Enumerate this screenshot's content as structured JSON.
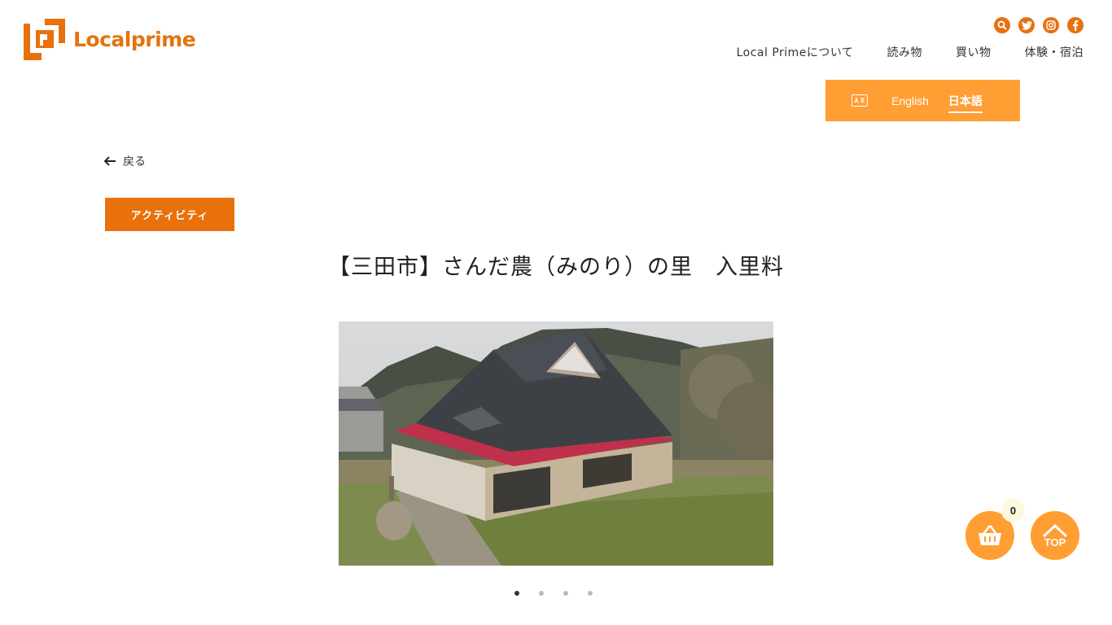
{
  "brand": {
    "name": "Localprime",
    "color": "#e6720e",
    "accent": "#ff9e33"
  },
  "social": [
    "search-icon",
    "twitter-icon",
    "instagram-icon",
    "facebook-icon"
  ],
  "nav": {
    "items": [
      "Local Primeについて",
      "読み物",
      "買い物",
      "体験・宿泊"
    ]
  },
  "language": {
    "icon": "translate-icon",
    "english": "English",
    "japanese": "日本語",
    "selected": "日本語"
  },
  "back": {
    "label": "戻る"
  },
  "category": {
    "label": "アクティビティ"
  },
  "page": {
    "title": "【三田市】さんだ農（みのり）の里　入里料"
  },
  "carousel": {
    "count": 4,
    "active": 1
  },
  "cart": {
    "count": "0"
  },
  "top_button": {
    "label": "TOP"
  }
}
